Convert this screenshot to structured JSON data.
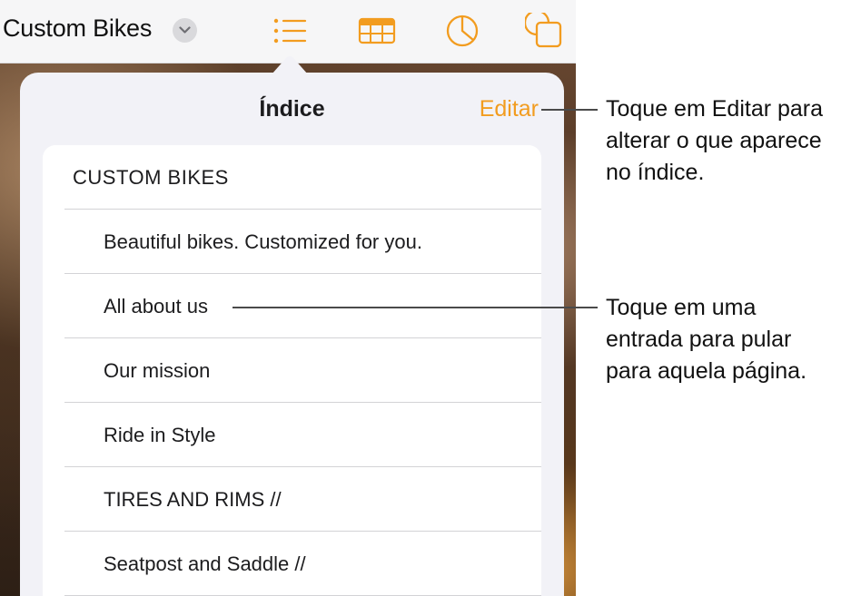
{
  "toolbar": {
    "doc_title": "Custom Bikes",
    "icons": [
      "chevron-down-icon",
      "list-icon",
      "table-icon",
      "chart-icon",
      "shapes-icon"
    ],
    "accent_color": "#f29c1f"
  },
  "popover": {
    "title": "Índice",
    "edit_label": "Editar",
    "entries": [
      {
        "label": "CUSTOM  BIKES",
        "level": 1
      },
      {
        "label": "Beautiful bikes. Customized for you.",
        "level": 2
      },
      {
        "label": "All about us",
        "level": 2
      },
      {
        "label": "Our mission",
        "level": 2
      },
      {
        "label": "Ride in Style",
        "level": 2
      },
      {
        "label": "TIRES AND RIMS //",
        "level": 2
      },
      {
        "label": "Seatpost and Saddle //",
        "level": 2
      }
    ]
  },
  "callouts": {
    "edit": "Toque em Editar para\nalterar o que aparece\nno índice.",
    "entry": "Toque em uma\nentrada para pular\npara aquela página."
  }
}
